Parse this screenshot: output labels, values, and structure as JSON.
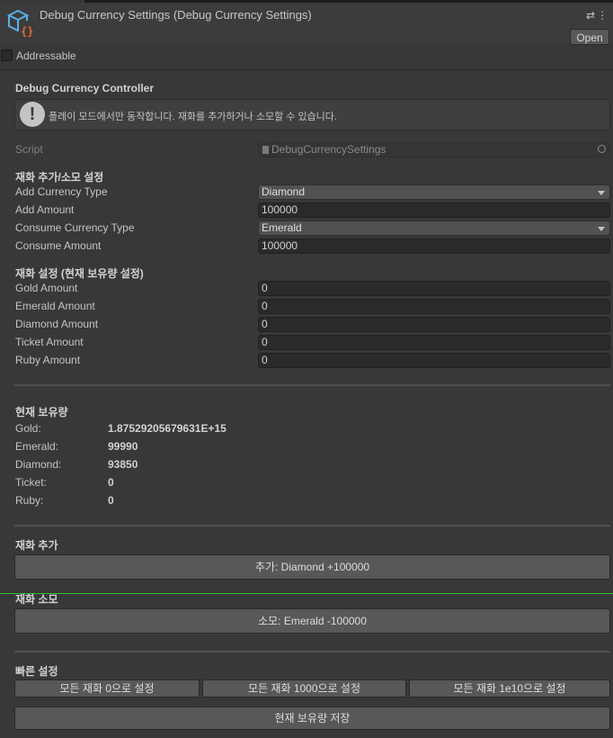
{
  "header": {
    "title": "Debug Currency Settings (Debug Currency Settings)",
    "open_label": "Open",
    "addressable_label": "Addressable"
  },
  "section": {
    "title": "Debug Currency Controller",
    "help_text": "플레이 모드에서만 동작합니다. 재화를 추가하거나 소모할 수 있습니다."
  },
  "script": {
    "label": "Script",
    "value": "DebugCurrencySettings"
  },
  "add_consume": {
    "heading": "재화 추가/소모 설정",
    "add_type_label": "Add Currency Type",
    "add_type_value": "Diamond",
    "add_amount_label": "Add Amount",
    "add_amount_value": "100000",
    "consume_type_label": "Consume Currency Type",
    "consume_type_value": "Emerald",
    "consume_amount_label": "Consume Amount",
    "consume_amount_value": "100000"
  },
  "set_amounts": {
    "heading": "재화 설정 (현재 보유량 설정)",
    "rows": [
      {
        "label": "Gold Amount",
        "value": "0"
      },
      {
        "label": "Emerald Amount",
        "value": "0"
      },
      {
        "label": "Diamond Amount",
        "value": "0"
      },
      {
        "label": "Ticket Amount",
        "value": "0"
      },
      {
        "label": "Ruby Amount",
        "value": "0"
      }
    ]
  },
  "current": {
    "heading": "현재 보유량",
    "rows": [
      {
        "label": "Gold:",
        "value": "1.87529205679631E+15"
      },
      {
        "label": "Emerald:",
        "value": "99990"
      },
      {
        "label": "Diamond:",
        "value": "93850"
      },
      {
        "label": "Ticket:",
        "value": "0"
      },
      {
        "label": "Ruby:",
        "value": "0"
      }
    ]
  },
  "add_section": {
    "heading": "재화 추가",
    "button": "추가: Diamond +100000"
  },
  "consume_section": {
    "heading": "재화 소모",
    "button": "소모: Emerald -100000"
  },
  "quick": {
    "heading": "빠른 설정",
    "btn_zero": "모든 재화 0으로 설정",
    "btn_1000": "모든 재화 1000으로 설정",
    "btn_1e10": "모든 재화 1e10으로 설정",
    "btn_save": "현재 보유량 저장"
  }
}
